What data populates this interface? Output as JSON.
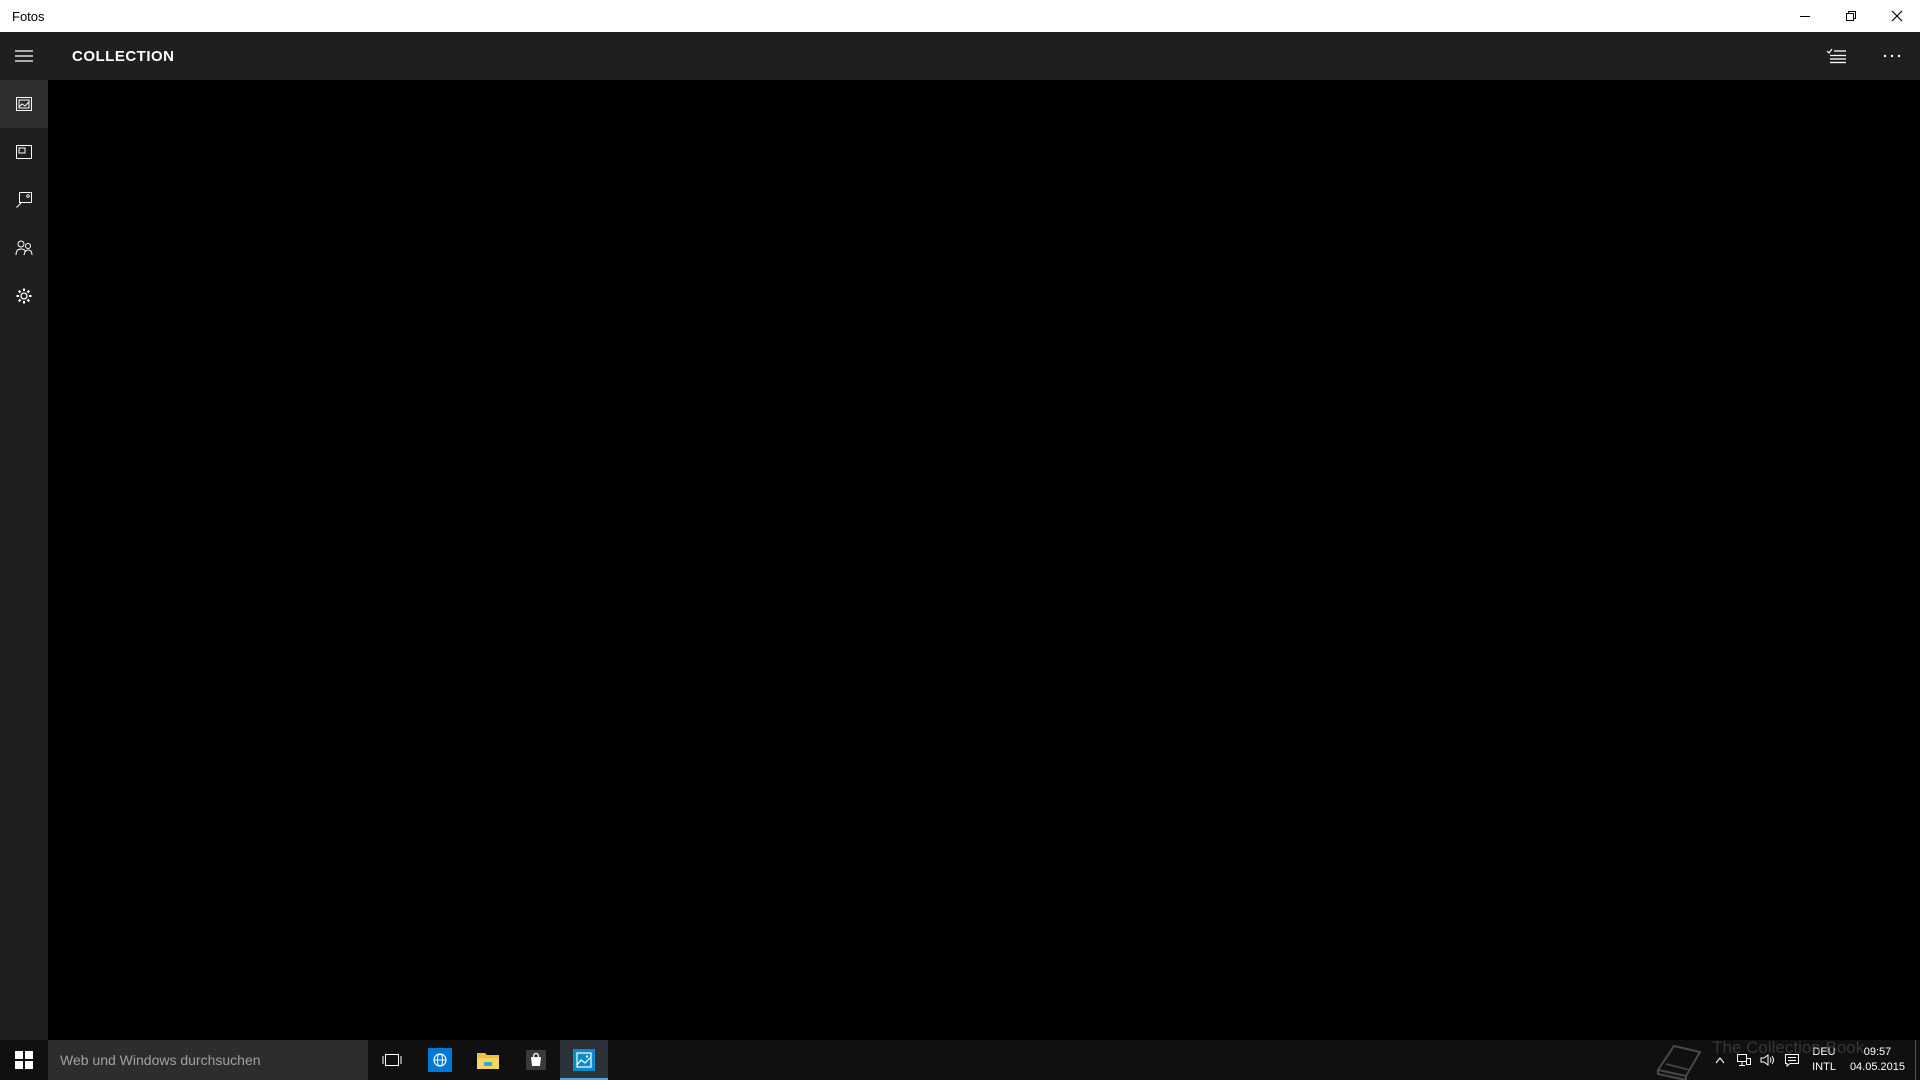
{
  "window": {
    "title": "Fotos"
  },
  "header": {
    "title": "COLLECTION",
    "actions": [
      "select-icon",
      "more-icon"
    ]
  },
  "nav": {
    "items": [
      {
        "name": "collection",
        "icon": "photos-icon",
        "active": true
      },
      {
        "name": "albums",
        "icon": "album-icon",
        "active": false
      },
      {
        "name": "folders",
        "icon": "folder-pictures-icon",
        "active": false
      },
      {
        "name": "people",
        "icon": "people-icon",
        "active": false
      },
      {
        "name": "settings",
        "icon": "gear-icon",
        "active": false
      }
    ]
  },
  "taskbar": {
    "search_placeholder": "Web und Windows durchsuchen",
    "pinned": [
      "task-view-icon",
      "browser-icon",
      "file-explorer-icon",
      "store-icon",
      "photos-icon"
    ],
    "active_app": "photos",
    "watermark": "The Collection Book",
    "tray": {
      "lang_top": "DEU",
      "lang_bottom": "INTL",
      "time": "09:57",
      "date": "04.05.2015"
    }
  },
  "colors": {
    "titlebar_bg": "#ffffff",
    "app_chrome_bg": "#1f1f1f",
    "content_bg": "#000000",
    "taskbar_bg": "#101010",
    "accent": "#0078d7"
  }
}
